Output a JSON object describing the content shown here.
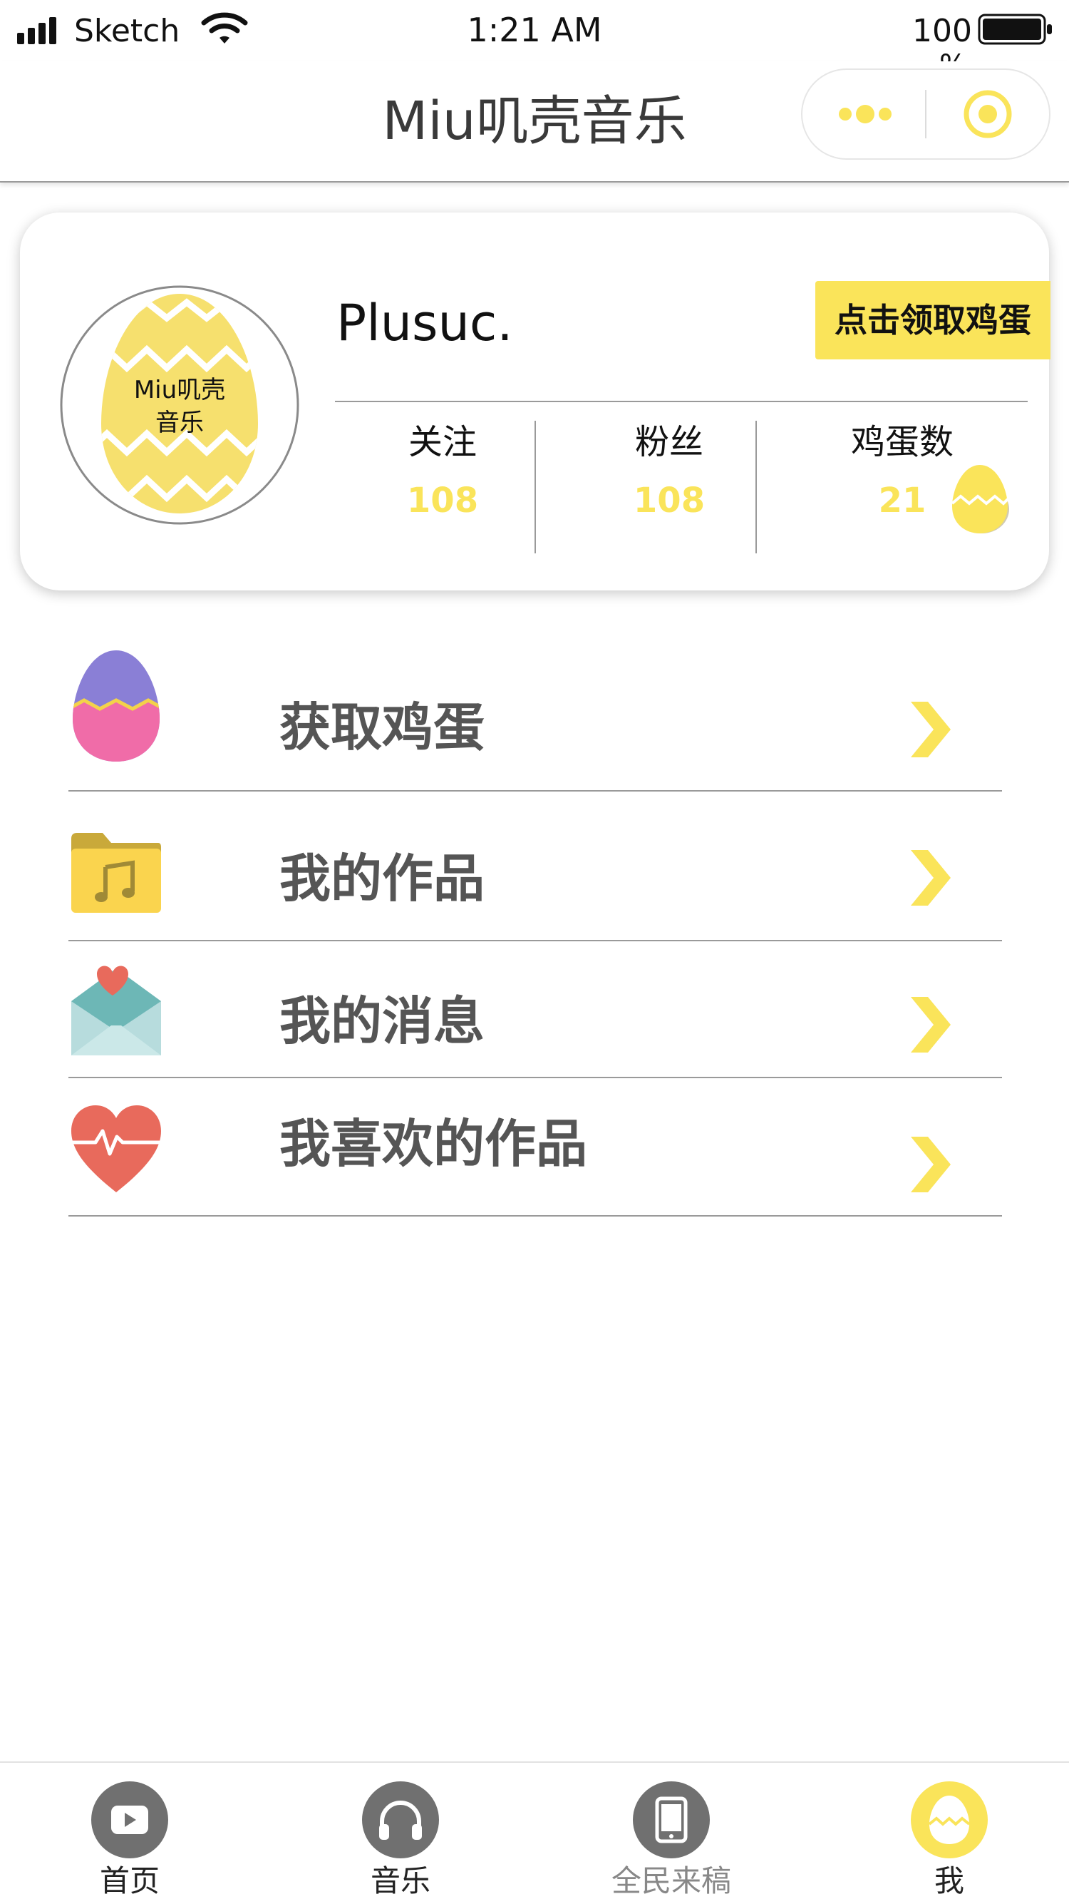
{
  "status_bar": {
    "carrier": "Sketch",
    "time": "1:21 AM",
    "battery_percent": "100",
    "battery_unit": "%"
  },
  "nav_bar": {
    "title": "Miu叽壳音乐",
    "more_icon": "more-dots-icon",
    "close_icon": "target-circle-icon",
    "accent_color": "#fae45a"
  },
  "profile": {
    "avatar_text_line1": "Miu叽壳",
    "avatar_text_line2": "音乐",
    "username": "Plusuc.",
    "claim_button": "点击领取鸡蛋",
    "stats": [
      {
        "label": "关注",
        "value": "108"
      },
      {
        "label": "粉丝",
        "value": "108"
      },
      {
        "label": "鸡蛋数",
        "value": "21"
      }
    ]
  },
  "menu": [
    {
      "label": "获取鸡蛋",
      "icon": "egg-icon"
    },
    {
      "label": "我的作品",
      "icon": "music-folder-icon"
    },
    {
      "label": "我的消息",
      "icon": "envelope-heart-icon"
    },
    {
      "label": "我喜欢的作品",
      "icon": "heart-pulse-icon"
    }
  ],
  "tab_bar": {
    "tabs": [
      {
        "label": "首页",
        "icon": "play-icon"
      },
      {
        "label": "音乐",
        "icon": "headphones-icon"
      },
      {
        "label": "全民来稿",
        "icon": "tablet-icon"
      },
      {
        "label": "我",
        "icon": "egg-icon"
      }
    ],
    "active": "我",
    "active_color": "#fae45a",
    "inactive_color": "#707070"
  }
}
